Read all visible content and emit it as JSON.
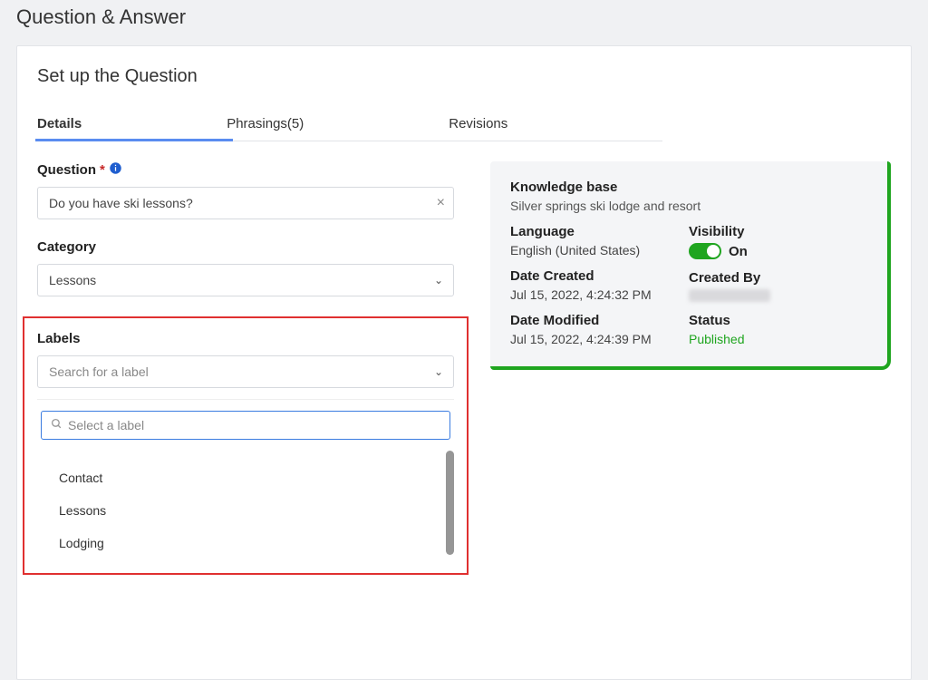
{
  "page_title": "Question & Answer",
  "card_title": "Set up the Question",
  "tabs": {
    "details": "Details",
    "phrasings": "Phrasings(5)",
    "revisions": "Revisions"
  },
  "form": {
    "question_label": "Question",
    "question_value": "Do you have ski lessons?",
    "category_label": "Category",
    "category_value": "Lessons",
    "labels_label": "Labels",
    "labels_placeholder": "Search for a label",
    "labels_search_placeholder": "Select a label",
    "label_options": [
      "Contact",
      "Lessons",
      "Lodging"
    ]
  },
  "meta": {
    "kb_label": "Knowledge base",
    "kb_value": "Silver springs ski lodge and resort",
    "language_label": "Language",
    "language_value": "English (United States)",
    "visibility_label": "Visibility",
    "visibility_on": "On",
    "date_created_label": "Date Created",
    "date_created_value": "Jul 15, 2022, 4:24:32 PM",
    "created_by_label": "Created By",
    "date_modified_label": "Date Modified",
    "date_modified_value": "Jul 15, 2022, 4:24:39 PM",
    "status_label": "Status",
    "status_value": "Published"
  },
  "colors": {
    "accent_green": "#1fa51f",
    "highlight_red": "#e03030",
    "tab_underline": "#5a8cf0"
  }
}
